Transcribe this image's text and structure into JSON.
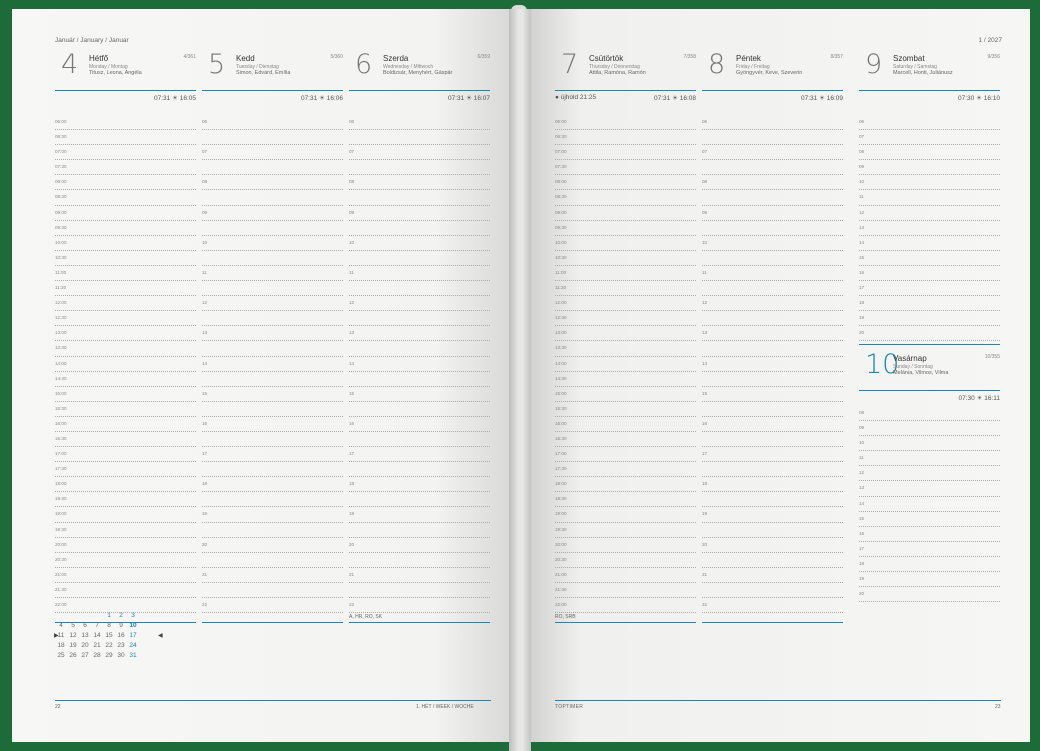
{
  "header": {
    "left_month": "Január / January / Januar",
    "right_week": "1 / 2027"
  },
  "days": [
    {
      "num": "4",
      "name": "Hétfő",
      "sub": "Monday / Montag",
      "names": "Titusz, Leona, Angéla",
      "idx": "4/361",
      "sun": "07:31 ☀ 16:05",
      "first_slot_label": "06:00"
    },
    {
      "num": "5",
      "name": "Kedd",
      "sub": "Tuesday / Dienstag",
      "names": "Simon, Edvárd, Emília",
      "idx": "5/360",
      "sun": "07:31 ☀ 16:06"
    },
    {
      "num": "6",
      "name": "Szerda",
      "sub": "Wednesday / Mittwoch",
      "names": "Boldizsár, Menyhért, Gáspár",
      "idx": "6/359",
      "sun": "07:31 ☀ 16:07",
      "footnote": "A, HR, RO, SK"
    },
    {
      "num": "7",
      "name": "Csütörtök",
      "sub": "Thursday / Donnerstag",
      "names": "Attila, Ramóna, Ramón",
      "idx": "7/358",
      "sun": "07:31 ☀ 16:08",
      "moon": "● újhold 21:25",
      "footnote": "RO, SRB"
    },
    {
      "num": "8",
      "name": "Péntek",
      "sub": "Friday / Freitag",
      "names": "Gyöngyvér, Keve, Szeverin",
      "idx": "8/357",
      "sun": "07:31 ☀ 16:09"
    },
    {
      "num": "9",
      "name": "Szombat",
      "sub": "Saturday / Samstag",
      "names": "Marcell, Honti, Juliánusz",
      "idx": "9/356",
      "sun": "07:30 ☀ 16:10"
    },
    {
      "num": "10",
      "name": "Vasárnap",
      "sub": "Sunday / Sonntag",
      "names": "Melánia, Vilmos, Vilma",
      "idx": "10/355",
      "sun": "07:30 ☀ 16:11"
    }
  ],
  "half_slots": [
    "06:00",
    "06:30",
    "07:00",
    "07:30",
    "08:00",
    "08:30",
    "09:00",
    "09:30",
    "10:00",
    "10:30",
    "11:00",
    "11:30",
    "12:00",
    "12:30",
    "13:00",
    "13:30",
    "14:00",
    "14:30",
    "15:00",
    "15:30",
    "16:00",
    "16:30",
    "17:00",
    "17:30",
    "18:00",
    "18:30",
    "19:00",
    "19:30",
    "20:00",
    "20:30",
    "21:00",
    "21:30",
    "22:00"
  ],
  "hour_slots": [
    "06",
    "",
    "07",
    "",
    "08",
    "",
    "09",
    "",
    "10",
    "",
    "11",
    "",
    "12",
    "",
    "13",
    "",
    "14",
    "",
    "15",
    "",
    "16",
    "",
    "17",
    "",
    "18",
    "",
    "19",
    "",
    "20",
    "",
    "21",
    "",
    "22"
  ],
  "sat_slots": [
    "06",
    "07",
    "08",
    "09",
    "10",
    "11",
    "12",
    "13",
    "14",
    "15",
    "16",
    "17",
    "18",
    "19",
    "20"
  ],
  "sun_slots": [
    "08",
    "09",
    "10",
    "11",
    "12",
    "13",
    "14",
    "15",
    "16",
    "17",
    "18",
    "19",
    "20"
  ],
  "mini_calendar": {
    "rows": [
      [
        "",
        "",
        "",
        "",
        "1",
        "2",
        "3"
      ],
      [
        "4",
        "5",
        "6",
        "7",
        "8",
        "9",
        "10"
      ],
      [
        "11",
        "12",
        "13",
        "14",
        "15",
        "16",
        "17"
      ],
      [
        "18",
        "19",
        "20",
        "21",
        "22",
        "23",
        "24"
      ],
      [
        "25",
        "26",
        "27",
        "28",
        "29",
        "30",
        "31"
      ]
    ]
  },
  "footer": {
    "left_page": "22",
    "week_label": "1. HÉT / WEEK / WOCHE",
    "brand": "TOPTIMER",
    "right_page": "23"
  }
}
